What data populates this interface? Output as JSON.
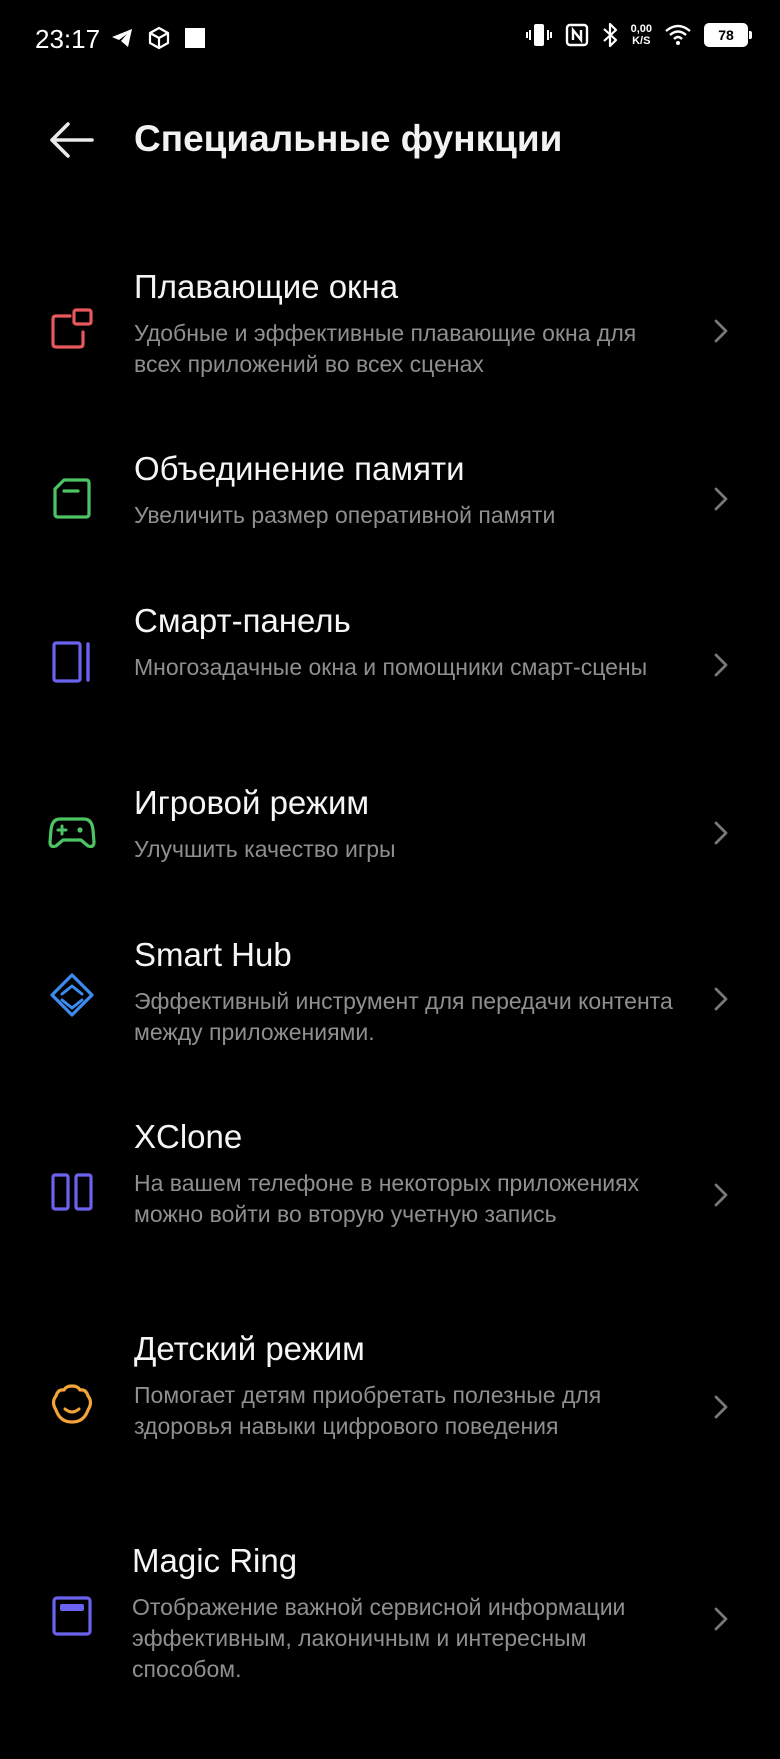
{
  "status_bar": {
    "time": "23:17",
    "net_speed_value": "0,00",
    "net_speed_unit": "K/S",
    "battery": "78"
  },
  "header": {
    "title": "Специальные функции",
    "back_icon": "arrow-left-icon"
  },
  "items": [
    {
      "title": "Плавающие окна",
      "desc": "Удобные и эффективные плавающие окна для всех приложений во всех сценах",
      "icon": "floating-window-icon",
      "color": "#e8585c"
    },
    {
      "title": "Объединение памяти",
      "desc": "Увеличить размер оперативной памяти",
      "icon": "memory-card-icon",
      "color": "#4cc465"
    },
    {
      "title": "Смарт-панель",
      "desc": "Многозадачные окна и помощники смарт-сцены",
      "icon": "side-panel-icon",
      "color": "#6b63f0"
    },
    {
      "title": "Игровой режим",
      "desc": "Улучшить качество игры",
      "icon": "gamepad-icon",
      "color": "#4cc465"
    },
    {
      "title": "Smart Hub",
      "desc": "Эффективный инструмент для передачи контента между приложениями.",
      "icon": "smart-hub-icon",
      "color": "#3e8bf0"
    },
    {
      "title": "XClone",
      "desc": "На вашем телефоне в некоторых приложениях можно войти во вторую учетную запись",
      "icon": "clone-icon",
      "color": "#6b63f0"
    },
    {
      "title": "Детский режим",
      "desc": "Помогает детям приобретать полезные для здоровья навыки цифрового поведения",
      "icon": "kid-mode-icon",
      "color": "#f2a43a"
    },
    {
      "title": "Magic Ring",
      "desc": "Отображение важной сервисной информации эффективным, лаконичным и интересным способом.",
      "icon": "magic-ring-icon",
      "color": "#6b63f0"
    }
  ]
}
